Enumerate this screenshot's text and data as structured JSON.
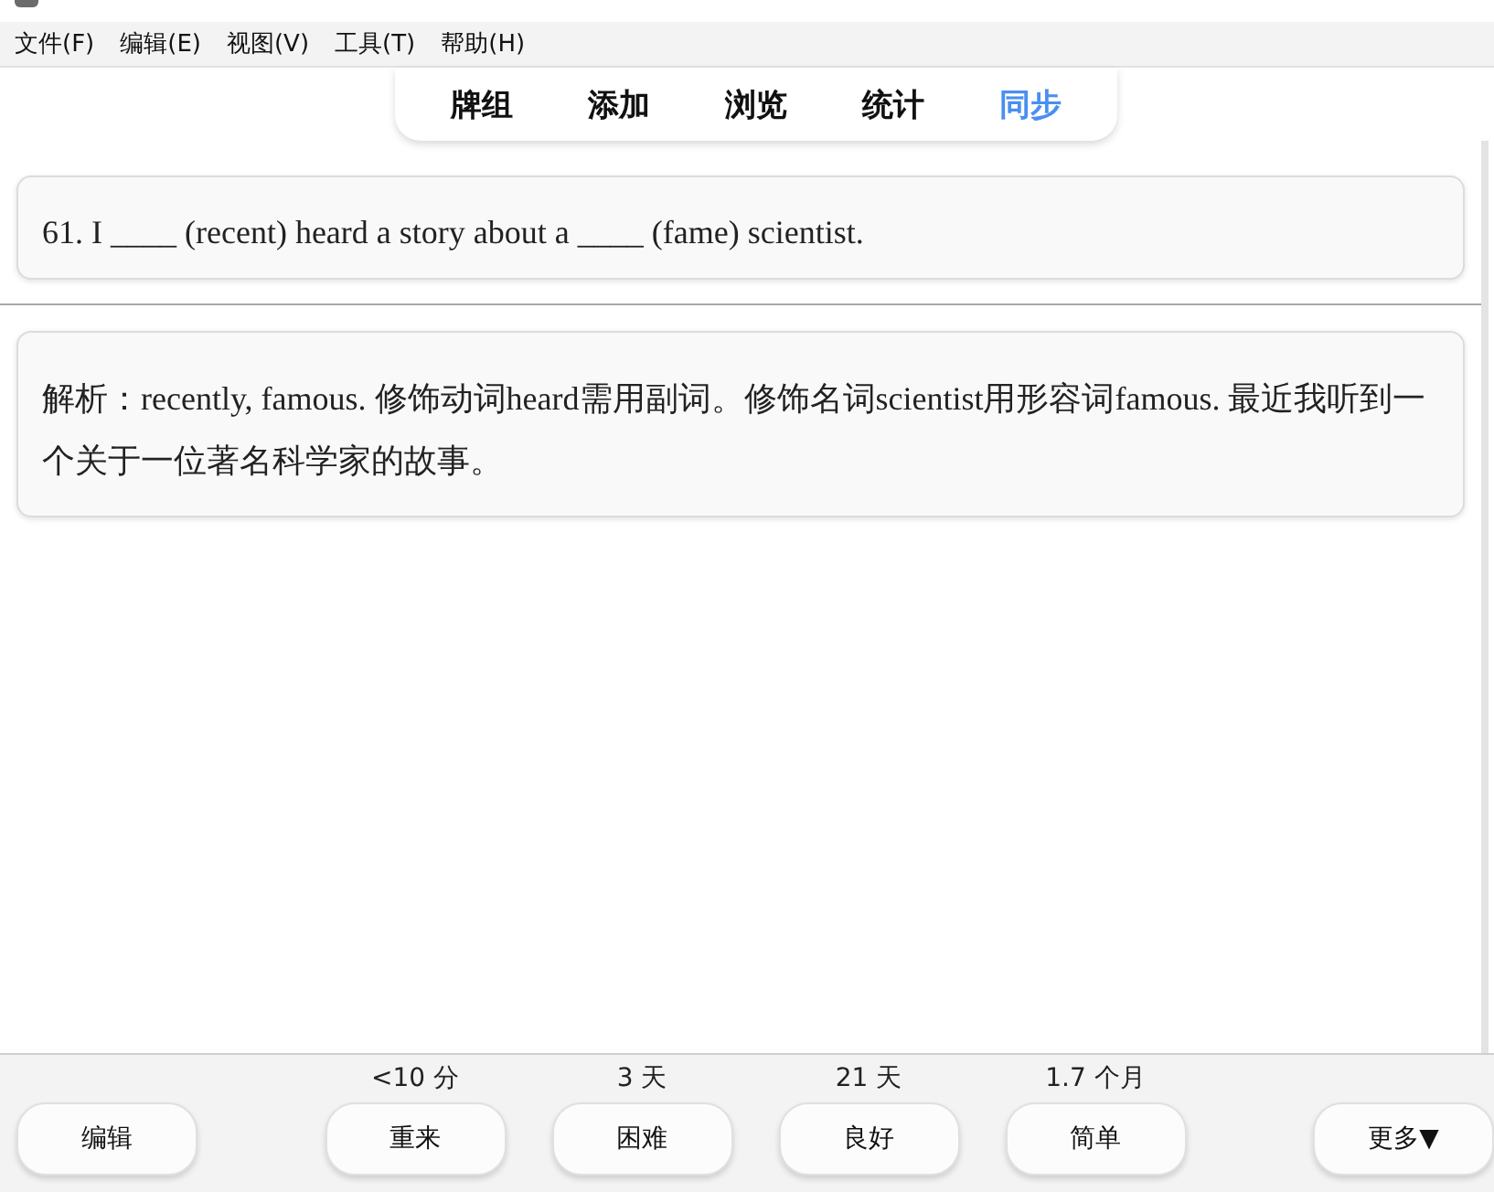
{
  "menu_bar": [
    {
      "label": "文件(F)"
    },
    {
      "label": "编辑(E)"
    },
    {
      "label": "视图(V)"
    },
    {
      "label": "工具(T)"
    },
    {
      "label": "帮助(H)"
    }
  ],
  "tabs": [
    {
      "label": "牌组",
      "selected": false
    },
    {
      "label": "添加",
      "selected": false
    },
    {
      "label": "浏览",
      "selected": false
    },
    {
      "label": "统计",
      "selected": false
    },
    {
      "label": "同步",
      "selected": true
    }
  ],
  "question": "61. I ____ (recent) heard a story about a ____ (fame) scientist.",
  "answer": "解析：recently, famous. 修饰动词heard需用副词。修饰名词scientist用形容词famous. 最近我听到一个关于一位著名科学家的故事。",
  "edit_button": "编辑",
  "answer_buttons": [
    {
      "label": "重来",
      "interval": "<10 分"
    },
    {
      "label": "困难",
      "interval": "3 天"
    },
    {
      "label": "良好",
      "interval": "21 天"
    },
    {
      "label": "简单",
      "interval": "1.7 个月"
    }
  ],
  "more_button": "更多▼"
}
